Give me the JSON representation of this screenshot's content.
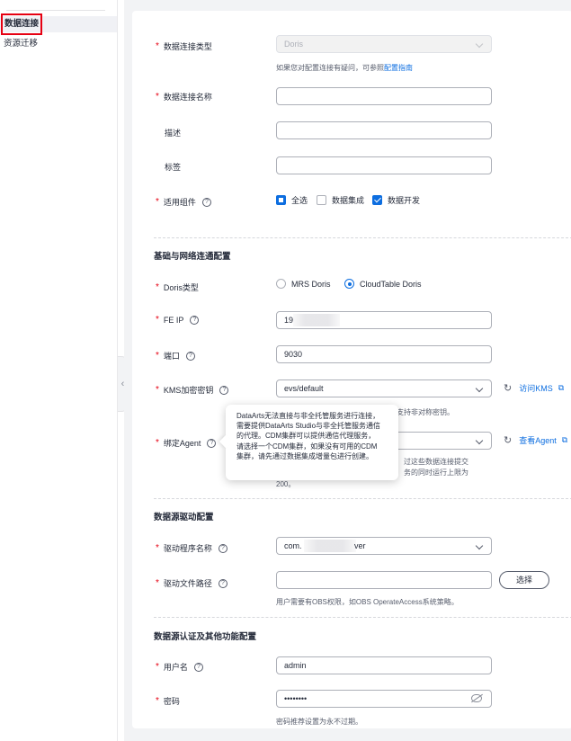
{
  "sidebar": {
    "items": [
      {
        "label": "数据连接",
        "active": true
      },
      {
        "label": "资源迁移",
        "active": false
      }
    ]
  },
  "form": {
    "conn_type": {
      "label": "数据连接类型",
      "value": "Doris",
      "hint_prefix": "如果您对配置连接有疑问，可参照",
      "hint_link": "配置指南"
    },
    "conn_name": {
      "label": "数据连接名称",
      "value": ""
    },
    "description": {
      "label": "描述",
      "value": ""
    },
    "tags": {
      "label": "标签",
      "value": ""
    },
    "components": {
      "label": "适用组件",
      "options": [
        {
          "label": "全选",
          "state": "partial"
        },
        {
          "label": "数据集成",
          "state": "unchecked"
        },
        {
          "label": "数据开发",
          "state": "checked"
        }
      ]
    }
  },
  "network": {
    "title": "基础与网络连通配置",
    "doris_type": {
      "label": "Doris类型",
      "options": [
        {
          "label": "MRS Doris",
          "selected": false
        },
        {
          "label": "CloudTable Doris",
          "selected": true
        }
      ]
    },
    "fe_ip": {
      "label": "FE IP",
      "value": "19"
    },
    "port": {
      "label": "端口",
      "value": "9030"
    },
    "kms": {
      "label": "KMS加密密钥",
      "value": "evs/default",
      "action": "访问KMS",
      "hint_tail": "不支持非对称密钥。"
    },
    "agent": {
      "label": "绑定Agent",
      "action": "查看Agent",
      "hint_line1": "过这些数据连接提交",
      "hint_line2": "务的同时运行上限为",
      "hint_line3": "200。"
    }
  },
  "tooltip": {
    "lines": [
      "DataArts无法直接与非全托管服务进行连接，",
      "需要提供DataArts Studio与非全托管服务通信",
      "的代理。CDM集群可以提供通信代理服务，",
      "请选择一个CDM集群，如果没有可用的CDM",
      "集群，请先通过数据集成增量包进行创建。"
    ]
  },
  "driver": {
    "title": "数据源驱动配置",
    "driver_name": {
      "label": "驱动程序名称",
      "value_prefix": "com.",
      "value_suffix": "ver"
    },
    "driver_path": {
      "label": "驱动文件路径",
      "value": "",
      "button": "选择",
      "hint": "用户需要有OBS权限，如OBS OperateAccess系统策略。"
    }
  },
  "auth": {
    "title": "数据源认证及其他功能配置",
    "username": {
      "label": "用户名",
      "value": "admin"
    },
    "password": {
      "label": "密码",
      "value": "••••••••",
      "hint": "密码推荐设置为永不过期。"
    }
  },
  "colors": {
    "accent": "#0d6ee0",
    "required": "#e60012",
    "highlight_box": "#e60012"
  }
}
